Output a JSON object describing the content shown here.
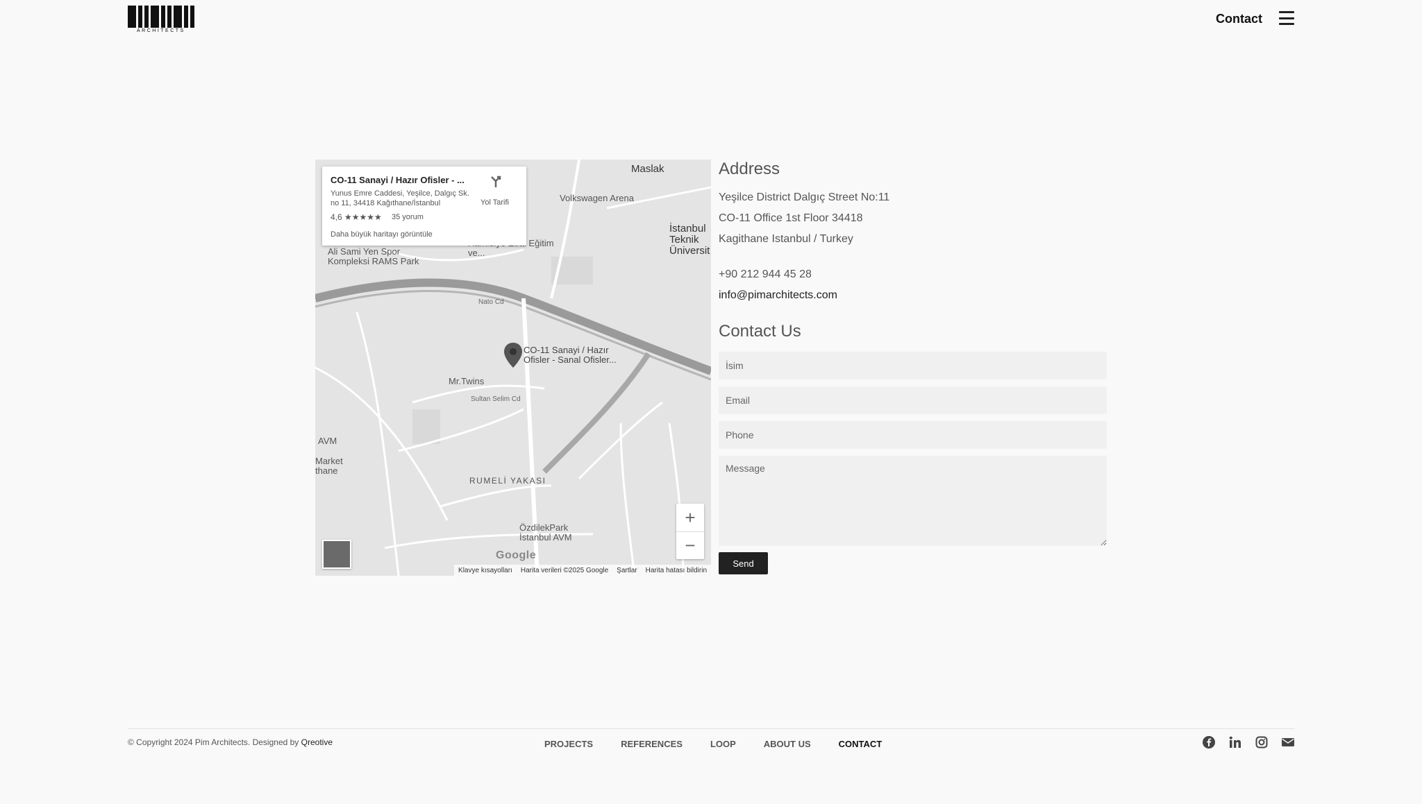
{
  "header": {
    "logo_text": "pim",
    "logo_sub": "ARCHITECTS",
    "nav_contact": "Contact"
  },
  "map": {
    "card_title": "CO-11 Sanayi / Hazır Ofisler - ...",
    "card_address": "Yunus Emre Caddesi, Yeşilce, Dalgıç Sk. no 11, 34418 Kağıthane/İstanbul",
    "rating": "4,6 ★★★★★",
    "reviews": "35 yorum",
    "bigger_map": "Daha büyük haritayı görüntüle",
    "directions": "Yol Tarifi",
    "pin_label": "CO-11 Sanayi / Hazır Ofisler - Sanal Ofisler...",
    "labels": {
      "maslak": "Maslak",
      "vw_arena": "Volkswagen Arena",
      "istanbul_teknik": "İstanbul Teknik Üniversit",
      "ali_sami": "Ali Sami Yen Spor Kompleksi RAMS Park",
      "hamidiye": "Hamidiye Etfal Eğitim ve...",
      "mr_twins": "Mr.Twins",
      "rumeli": "RUMELİ YAKASI",
      "ozdilek": "ÖzdilekPark İstanbul AVM",
      "nato": "Nato Cd",
      "sultan": "Sultan Selim Cd",
      "avm": "AVM",
      "market": "Market thane"
    },
    "google": "Google",
    "attribution": [
      "Klavye kısayolları",
      "Harita verileri ©2025 Google",
      "Şartlar",
      "Harita hatası bildirin"
    ],
    "zoom_in": "+",
    "zoom_out": "−"
  },
  "address": {
    "title": "Address",
    "line1": "Yeşilce District Dalgıç Street No:11",
    "line2": "CO-11 Office 1st Floor 34418",
    "line3": "Kagithane Istanbul / Turkey",
    "phone": "+90 212 944 45 28",
    "email": "info@pimarchitects.com"
  },
  "contact_form": {
    "title": "Contact Us",
    "name_placeholder": "İsim",
    "email_placeholder": "Email",
    "phone_placeholder": "Phone",
    "message_placeholder": "Message",
    "send_label": "Send"
  },
  "footer": {
    "copyright": "© Copyright 2024 Pim Architects. Designed by",
    "designer": "Qreotive",
    "nav": [
      "PROJECTS",
      "REFERENCES",
      "LOOP",
      "ABOUT US",
      "CONTACT"
    ],
    "active": "CONTACT",
    "social_icons": [
      "facebook-icon",
      "linkedin-icon",
      "instagram-icon",
      "mail-icon"
    ]
  }
}
